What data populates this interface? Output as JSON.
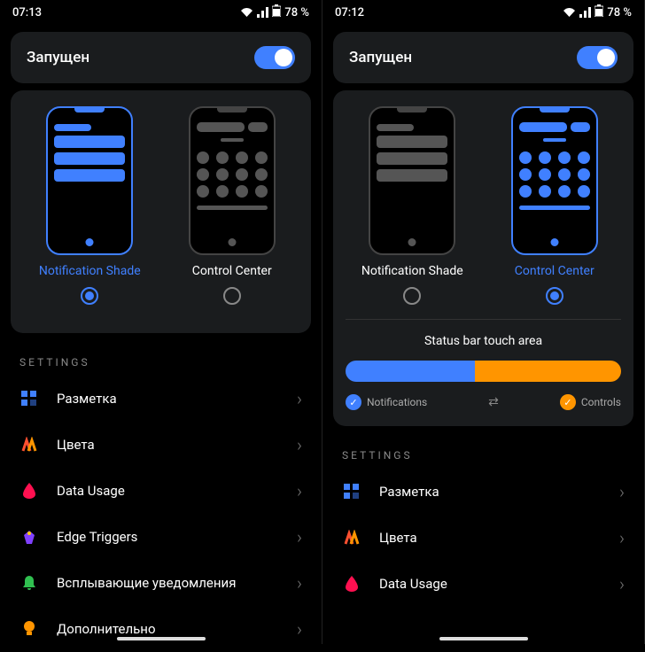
{
  "left": {
    "status": {
      "time": "07:13",
      "battery": "78 %"
    },
    "header": {
      "title": "Запущен"
    },
    "options": {
      "notification": {
        "label": "Notification Shade",
        "selected": true
      },
      "control": {
        "label": "Control Center",
        "selected": false
      }
    },
    "settings_header": "SETTINGS",
    "settings": [
      {
        "icon": "layout",
        "label": "Разметка"
      },
      {
        "icon": "colors",
        "label": "Цвета"
      },
      {
        "icon": "drop",
        "label": "Data Usage"
      },
      {
        "icon": "edge",
        "label": "Edge Triggers"
      },
      {
        "icon": "bell",
        "label": "Всплывающие уведомления"
      },
      {
        "icon": "bulb",
        "label": "Дополнительно"
      }
    ]
  },
  "right": {
    "status": {
      "time": "07:12",
      "battery": "78 %"
    },
    "header": {
      "title": "Запущен"
    },
    "options": {
      "notification": {
        "label": "Notification Shade",
        "selected": false
      },
      "control": {
        "label": "Control Center",
        "selected": true
      }
    },
    "touch_area": {
      "title": "Status bar touch area",
      "left_label": "Notifications",
      "right_label": "Controls"
    },
    "settings_header": "SETTINGS",
    "settings": [
      {
        "icon": "layout",
        "label": "Разметка"
      },
      {
        "icon": "colors",
        "label": "Цвета"
      },
      {
        "icon": "drop",
        "label": "Data Usage"
      }
    ]
  }
}
